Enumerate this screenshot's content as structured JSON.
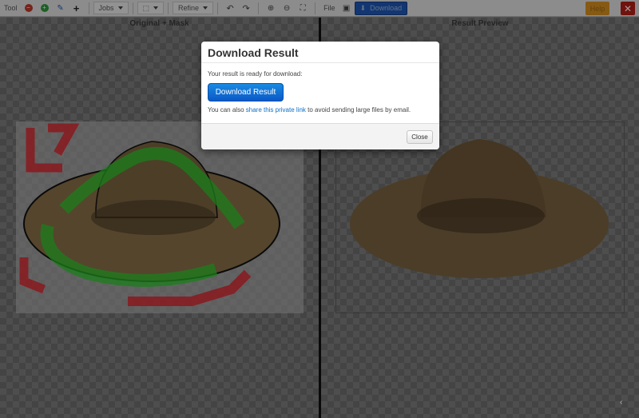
{
  "toolbar": {
    "tool_label": "Tool",
    "jobs_label": "Jobs",
    "refine_label": "Refine",
    "file_label": "File",
    "download_label": "Download",
    "gold_label": "Help",
    "close_symbol": "✕",
    "icons": [
      "minus-icon",
      "plus-icon",
      "pin-icon",
      "crosshair-icon",
      "crop-icon",
      "undo-icon",
      "redo-icon",
      "zoom-in-icon",
      "zoom-out-icon",
      "fullscreen-icon",
      "save-icon",
      "download-icon"
    ]
  },
  "left_pane": {
    "title": "Original + Mask"
  },
  "right_pane": {
    "title": "Result Preview"
  },
  "modal": {
    "title": "Download Result",
    "ready_text": "Your result is ready for download:",
    "primary_button": "Download Result",
    "text_before_link": "You can also ",
    "link_text": "share this private link",
    "text_after_link": " to avoid sending large files by email.",
    "close_button": "Close"
  },
  "colors": {
    "accent_blue": "#0a59c8",
    "mask_green": "#2cc92c",
    "mask_red": "#e0202a",
    "hat_brown": "#8a7047"
  }
}
